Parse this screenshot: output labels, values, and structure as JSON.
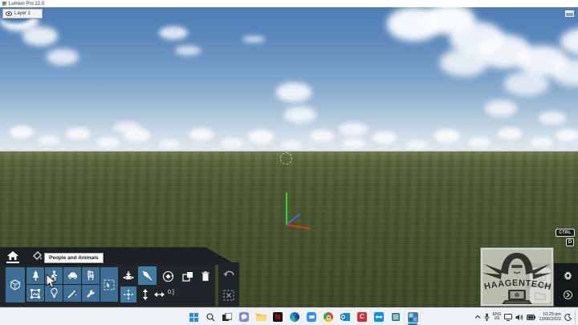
{
  "window": {
    "title": "Lumion Pro 12.0",
    "app_icon": "lumion-logo-icon"
  },
  "scene": {
    "layer_button_label": "Layer 1",
    "tooltip_text": "People and Animals",
    "ctrl_key_badge": "CTRL",
    "d_key_badge": "D",
    "precision_value": "0.]",
    "colors": {
      "sky_top": "#4d7db5",
      "sky_horizon": "#dde6ec",
      "grass": "#49572f",
      "toolbar_blue": "#3e6e93",
      "panel_dark": "#1e242a",
      "taskbar_accent": "#1a73c7"
    }
  },
  "toolbar": {
    "tabs": [
      {
        "icon": "home-icon",
        "active": true
      },
      {
        "icon": "paint-bucket-icon",
        "active": false
      }
    ],
    "category_icons": [
      "cube-icon",
      "tree-icon",
      "person-icon",
      "car-icon",
      "chair-icon",
      "picture-icon",
      "lightbulb-icon",
      "magic-wand-icon",
      "wrench-icon",
      "marquee-icon"
    ],
    "tool_icons": [
      "place-object-icon",
      "pointer-icon",
      "rotate-icon",
      "scale-icon",
      "trash-icon",
      "move-icon",
      "move-vertical-icon",
      "move-horizontal-icon"
    ],
    "side_icons": [
      "undo-icon",
      "marquee-clear-icon"
    ]
  },
  "watermark": {
    "brand": "HAAGENTECH"
  },
  "right_panel": {
    "icons": [
      "photo-icon",
      "folder-icon",
      "gear-icon",
      "arrow-icon"
    ]
  },
  "taskbar": {
    "app_icons": [
      "windows-start-icon",
      "search-icon",
      "task-view-icon",
      "chat-icon",
      "file-explorer-icon",
      "netflix-icon",
      "edge-icon",
      "zoom-icon",
      "chrome-icon",
      "outlook-icon",
      "c-app-icon",
      "teamviewer-icon",
      "scanner-icon",
      "lumion-icon"
    ],
    "active_app": "lumion",
    "netflix_letter": "N",
    "c_app_letter": "C",
    "tray": {
      "language": "ENG",
      "region": "US",
      "time": "10:29 pm",
      "date": "13/06/2022"
    }
  }
}
